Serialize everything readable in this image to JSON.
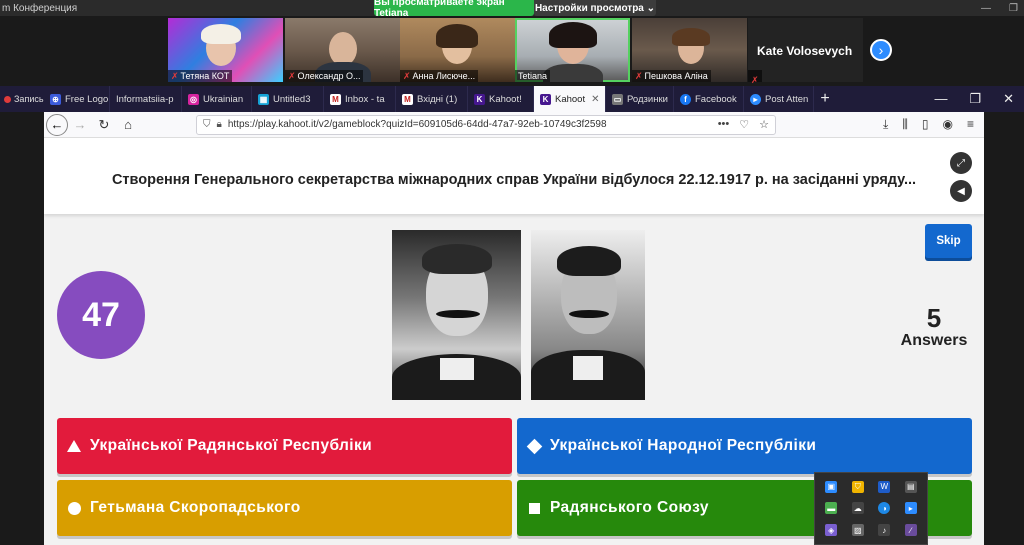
{
  "zoom": {
    "title": "m Конференция",
    "share_banner": "Вы просматриваете экран Tetiana",
    "view_options": "Настройки просмотра ⌄",
    "participants": [
      {
        "name": "Тетяна КОТ"
      },
      {
        "name": "Олександр О..."
      },
      {
        "name": "Анна Лисюче..."
      },
      {
        "name": "Tetiana"
      },
      {
        "name": "Пешкова Аліна"
      }
    ],
    "extra_participant": "Kate Volosevych",
    "record_label": "Запись"
  },
  "browser": {
    "tabs": [
      {
        "label": "Free Logo",
        "icon": "free-logo-icon",
        "color": "#3b5bdb"
      },
      {
        "label": "Informatsiia-p",
        "icon": "doc-icon",
        "color": "#555555"
      },
      {
        "label": "Ukrainian",
        "icon": "instagram-icon",
        "color": "#d6249f"
      },
      {
        "label": "Untitled3",
        "icon": "grid-icon",
        "color": "#16a3d6"
      },
      {
        "label": "Inbox - ta",
        "icon": "gmail-icon",
        "color": "#c5221f"
      },
      {
        "label": "Вхідні (1)",
        "icon": "gmail-icon",
        "color": "#c5221f"
      },
      {
        "label": "Kahoot!",
        "icon": "kahoot-icon",
        "color": "#46178f"
      },
      {
        "label": "Kahoot",
        "icon": "kahoot-icon",
        "color": "#46178f",
        "active": true
      },
      {
        "label": "Родзинки",
        "icon": "page-icon",
        "color": "#777777"
      },
      {
        "label": "Facebook",
        "icon": "facebook-icon",
        "color": "#1877f2"
      },
      {
        "label": "Post Atten",
        "icon": "zoom-icon",
        "color": "#2d8cff"
      }
    ],
    "url": "https://play.kahoot.it/v2/gameblock?quizId=609105d6-64dd-47a7-92eb-10749c3f2598"
  },
  "kahoot": {
    "question": "Створення Генерального секретарства міжнародних справ України відбулося 22.12.1917 р. на засіданні уряду...",
    "skip_label": "Skip",
    "timer": "47",
    "answers_count": "5",
    "answers_label": "Answers",
    "options": [
      "Української Радянської Республіки",
      "Української Народної Республіки",
      "Гетьмана Скоропадського",
      "Радянського Союзу"
    ]
  }
}
